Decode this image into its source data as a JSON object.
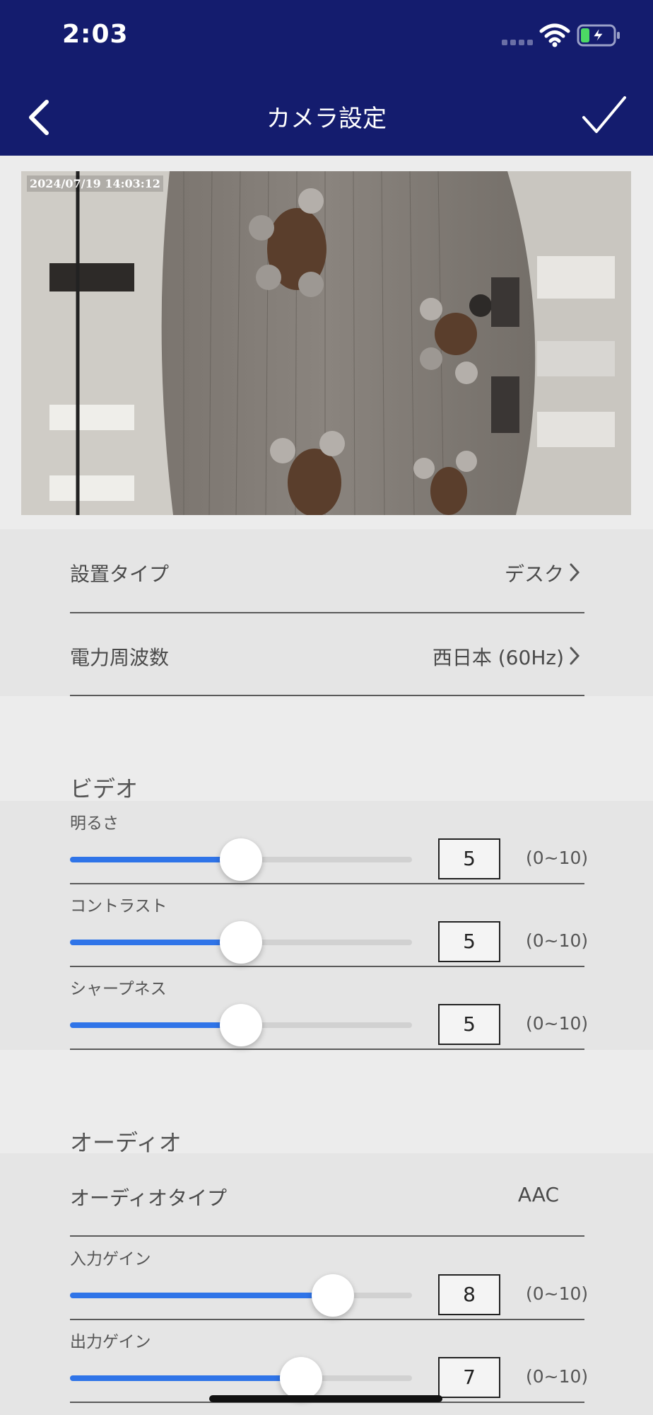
{
  "status_bar": {
    "time": "2:03"
  },
  "nav": {
    "title": "カメラ設定"
  },
  "preview": {
    "timestamp": "2024/07/19 14:03:12"
  },
  "settings": {
    "install_type": {
      "label": "設置タイプ",
      "value": "デスク"
    },
    "power_frequency": {
      "label": "電力周波数",
      "value": "西日本 (60Hz)"
    }
  },
  "video": {
    "title": "ビデオ",
    "sliders": [
      {
        "label": "明るさ",
        "value": "5",
        "level": 0.5,
        "range": "(0~10)"
      },
      {
        "label": "コントラスト",
        "value": "5",
        "level": 0.5,
        "range": "(0~10)"
      },
      {
        "label": "シャープネス",
        "value": "5",
        "level": 0.5,
        "range": "(0~10)"
      }
    ]
  },
  "audio": {
    "title": "オーディオ",
    "type": {
      "label": "オーディオタイプ",
      "value": "AAC"
    },
    "sliders": [
      {
        "label": "入力ゲイン",
        "value": "8",
        "level": 0.8,
        "range": "(0~10)"
      },
      {
        "label": "出力ゲイン",
        "value": "7",
        "level": 0.7,
        "range": "(0~10)"
      }
    ]
  },
  "colors": {
    "header": "#141c6e",
    "accent": "#2f74e8",
    "battery": "#4cd964"
  },
  "icons": [
    "wifi-icon",
    "battery-charging-icon",
    "back-chevron-icon",
    "checkmark-icon",
    "chevron-right-icon"
  ]
}
